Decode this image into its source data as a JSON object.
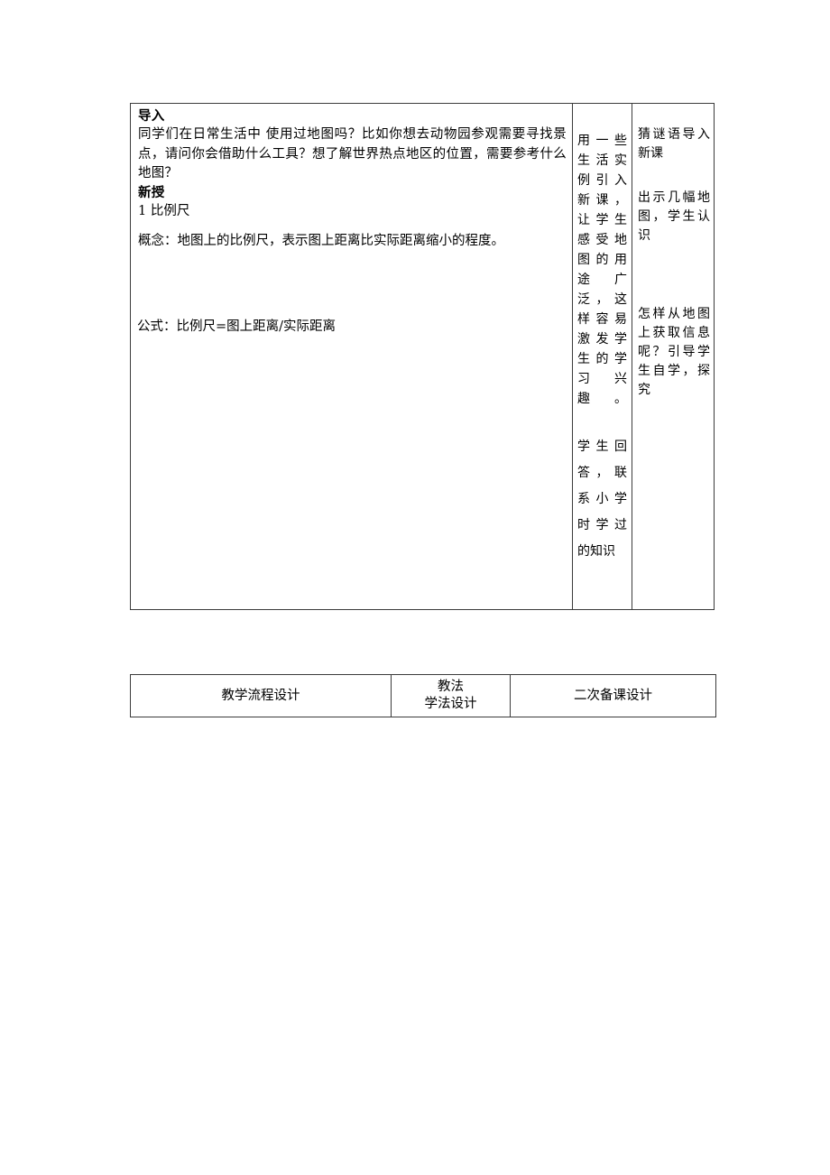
{
  "document": {
    "type": "lesson-plan-table",
    "language": "zh-CN"
  },
  "main_table": {
    "flow_column": {
      "heading_intro": "导入",
      "intro_paragraph": "同学们在日常生活中  使用过地图吗？比如你想去动物园参观需要寻找景点，请问你会借助什么工具？想了解世界热点地区的位置，需要参考什么地图？",
      "heading_new": "新授",
      "item_1": "1 比例尺",
      "concept": "概念：地图上的比例尺，表示图上距离比实际距离缩小的程度。",
      "formula": "公式：比例尺=图上距离/实际距离"
    },
    "method_column": {
      "paragraph_1": "用一些生活实例引入新课，让学生感受地图的用途广泛，这样容易激发学生的学习兴趣。",
      "paragraph_2": "学生回答，联系小学时学过的知识"
    },
    "second_prep_column": {
      "paragraph_1": "猜谜语导入新课",
      "paragraph_2": "出示几幅地图，学生认识",
      "paragraph_3": "怎样从地图上获取信息呢？引导学生自学，探究"
    }
  },
  "footer_table": {
    "headers": [
      "教学流程设计",
      "教法\n学法设计",
      "二次备课设计"
    ],
    "header_col2_line1": "教法",
    "header_col2_line2": "学法设计"
  },
  "colors": {
    "border": "#3b3b3b",
    "text": "#000000",
    "edit_mark": "#e8a000",
    "background": "#ffffff"
  }
}
